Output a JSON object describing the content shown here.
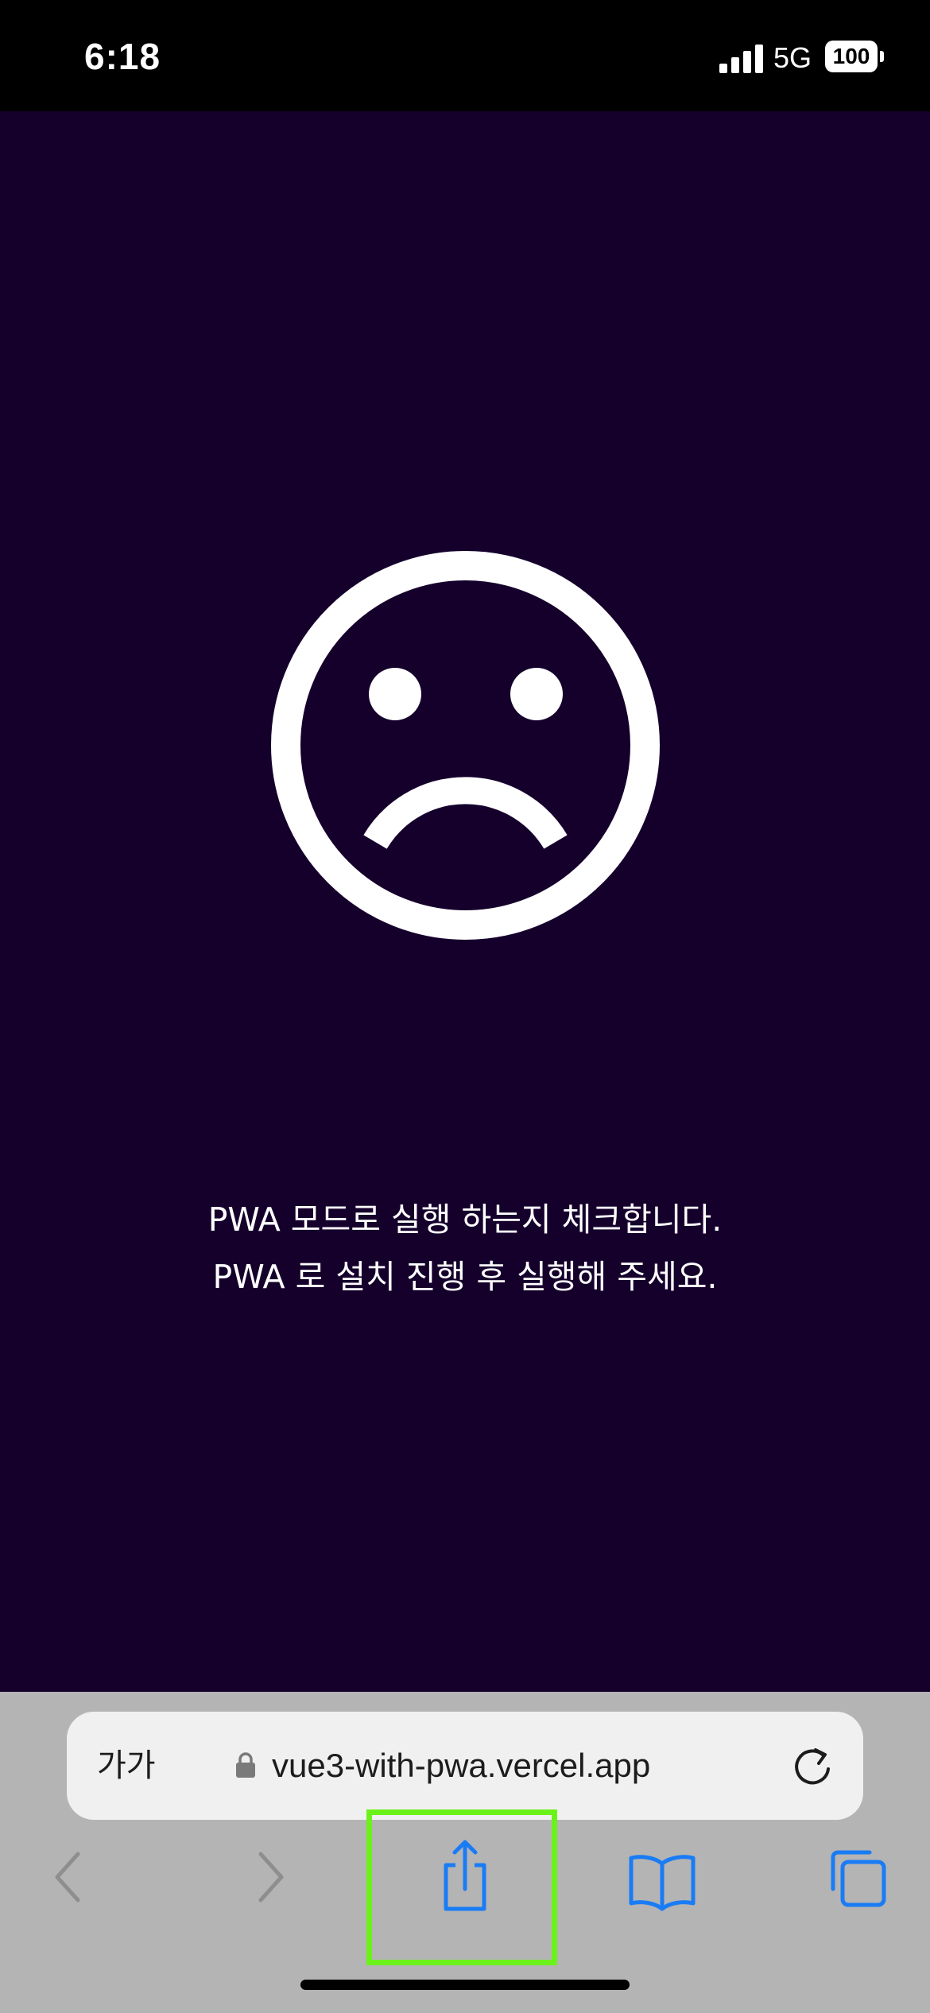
{
  "status_bar": {
    "time": "6:18",
    "network": "5G",
    "battery": "100"
  },
  "page": {
    "icon": "sad-face-icon",
    "message_line1": "PWA 모드로 실행 하는지 체크합니다.",
    "message_line2": "PWA 로 설치 진행 후 실행해 주세요.",
    "background_color": "#15002c"
  },
  "browser": {
    "text_size_label": "가가",
    "url": "vue3-with-pwa.vercel.app",
    "toolbar_icons": [
      "back-icon",
      "forward-icon",
      "share-icon",
      "bookmarks-icon",
      "tabs-icon"
    ],
    "accent_color": "#1a7cf5",
    "highlight_color": "#6cf21b"
  }
}
